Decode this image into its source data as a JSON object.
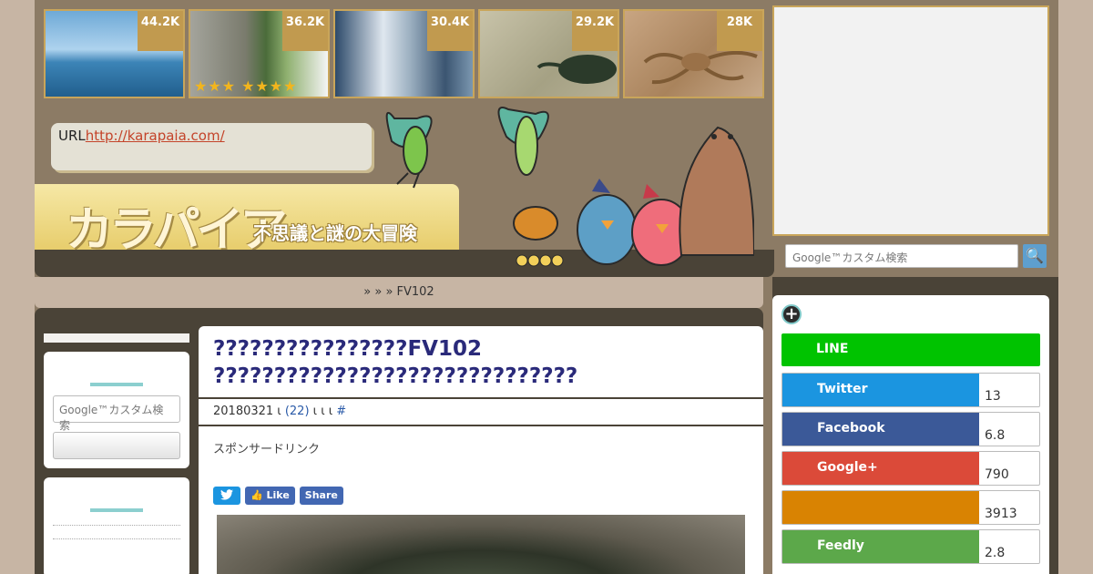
{
  "thumbnails": [
    {
      "count": "44.2K"
    },
    {
      "count": "36.2K"
    },
    {
      "count": "30.4K"
    },
    {
      "count": "29.2K"
    },
    {
      "count": "28K"
    }
  ],
  "thumb2_stars": "★★★ ★★★★",
  "url_label": "URL",
  "url_link": "http://karapaia.com/",
  "logo_text": "カラパイア",
  "tagline": "不思議と謎の大冒険",
  "breadcrumb": "»   »  » FV102",
  "article": {
    "title": "????????????????FV102 ??????????????????????????????",
    "meta_date": "20180321",
    "meta_sep1": " ι ",
    "meta_comments": "(22)",
    "meta_sep2": " ι ι ι ",
    "meta_hash": "#",
    "sponsor_label": "スポンサードリンク"
  },
  "share_buttons": {
    "like": "Like",
    "share": "Share"
  },
  "search": {
    "placeholder": "Google™カスタム検索",
    "go_glyph": "🔍"
  },
  "share_panel": {
    "plus_glyph": "+",
    "rows": [
      {
        "label": "LINE",
        "count": "",
        "color": "#00c300"
      },
      {
        "label": "Twitter",
        "count": "13",
        "color": "#1b95e0"
      },
      {
        "label": "Facebook",
        "count": "6.8",
        "color": "#3b5998"
      },
      {
        "label": "Google+",
        "count": "790",
        "color": "#db4a39"
      },
      {
        "label": "",
        "count": "3913",
        "color": "#d98302"
      },
      {
        "label": "Feedly",
        "count": "2.8",
        "color": "#5ca84a"
      }
    ]
  }
}
